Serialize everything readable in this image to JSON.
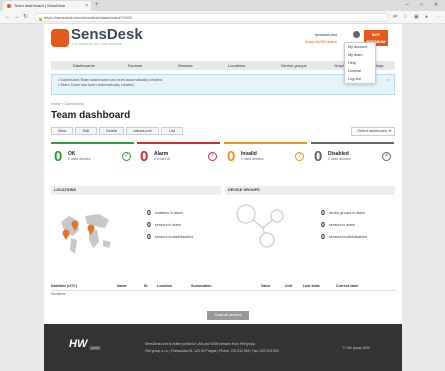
{
  "browser": {
    "tab_title": "Team dashboard | SensDesk",
    "url": "https://sensdesk.com/sensdesk/dashboard/?1490",
    "new_tab": "+",
    "window": {
      "minimize": "–",
      "maximize": "□",
      "close": "✕"
    }
  },
  "header": {
    "logo": "SensDesk",
    "logo_sub": "IoT PORTAL BY HW GROUP",
    "user": "sensdesk-test",
    "device_info": "Adopt 60/HB device",
    "buy_label": "BUY",
    "buy_sub": "PREMIUM"
  },
  "user_menu": [
    "My account",
    "My team",
    "Help",
    "License",
    "Log out"
  ],
  "nav": [
    "Dashboards",
    "Devices",
    "Sensors",
    "Locations",
    "Device groups",
    "Graphs",
    "Settings"
  ],
  "alert": {
    "lines": [
      "Dashboard Team dashboard has been automatically created.",
      "Team Team has been automatically created."
    ]
  },
  "breadcrumb": "Home » Dashboards",
  "page_title": "Team dashboard",
  "actions": [
    "View",
    "Edit",
    "Delete",
    "values.xml",
    "List"
  ],
  "select_dashboard": "- Select dashboard -",
  "statuses": [
    {
      "count": "0",
      "label": "OK",
      "sub": "0 used devices",
      "color": "#2e9e3a"
    },
    {
      "count": "0",
      "label": "Alarm",
      "sub": "0 in last 2h",
      "color": "#d92b2b"
    },
    {
      "count": "0",
      "label": "Invalid",
      "sub": "0 used devices",
      "color": "#f0901e"
    },
    {
      "count": "0",
      "label": "Disabled",
      "sub": "0 used devices",
      "color": "#666666"
    }
  ],
  "locations": {
    "title": "LOCATIONS",
    "rows": [
      {
        "count": "0",
        "text": "locations in alarm"
      },
      {
        "count": "0",
        "text": "sensors in alarm"
      },
      {
        "count": "0",
        "text": "sensors invalid/disabled"
      }
    ]
  },
  "device_groups": {
    "title": "DEVICE GROUPS",
    "rows": [
      {
        "count": "0",
        "text": "device groups in alarm"
      },
      {
        "count": "0",
        "text": "sensors in alarm"
      },
      {
        "count": "0",
        "text": "sensors invalid/disabled"
      }
    ]
  },
  "table": {
    "headers": [
      "Datetime (UTC)",
      "Name",
      "ID",
      "Location",
      "Sublocation",
      "Value",
      "Unit",
      "Last state",
      "Current state"
    ],
    "empty": "No items."
  },
  "show_all": "Show all sensors",
  "footer": {
    "logo": "HW",
    "logo_sub": "group",
    "line1": "SensDesk.com is online portal for LAN and GSM sensors from HW group.",
    "line2": "HW group s.r.o. | Rumunská 26, 120 00 Prague | Phone: 222 511 918 | Fax: 222 513 833",
    "copyright": "© HW group 2020"
  }
}
